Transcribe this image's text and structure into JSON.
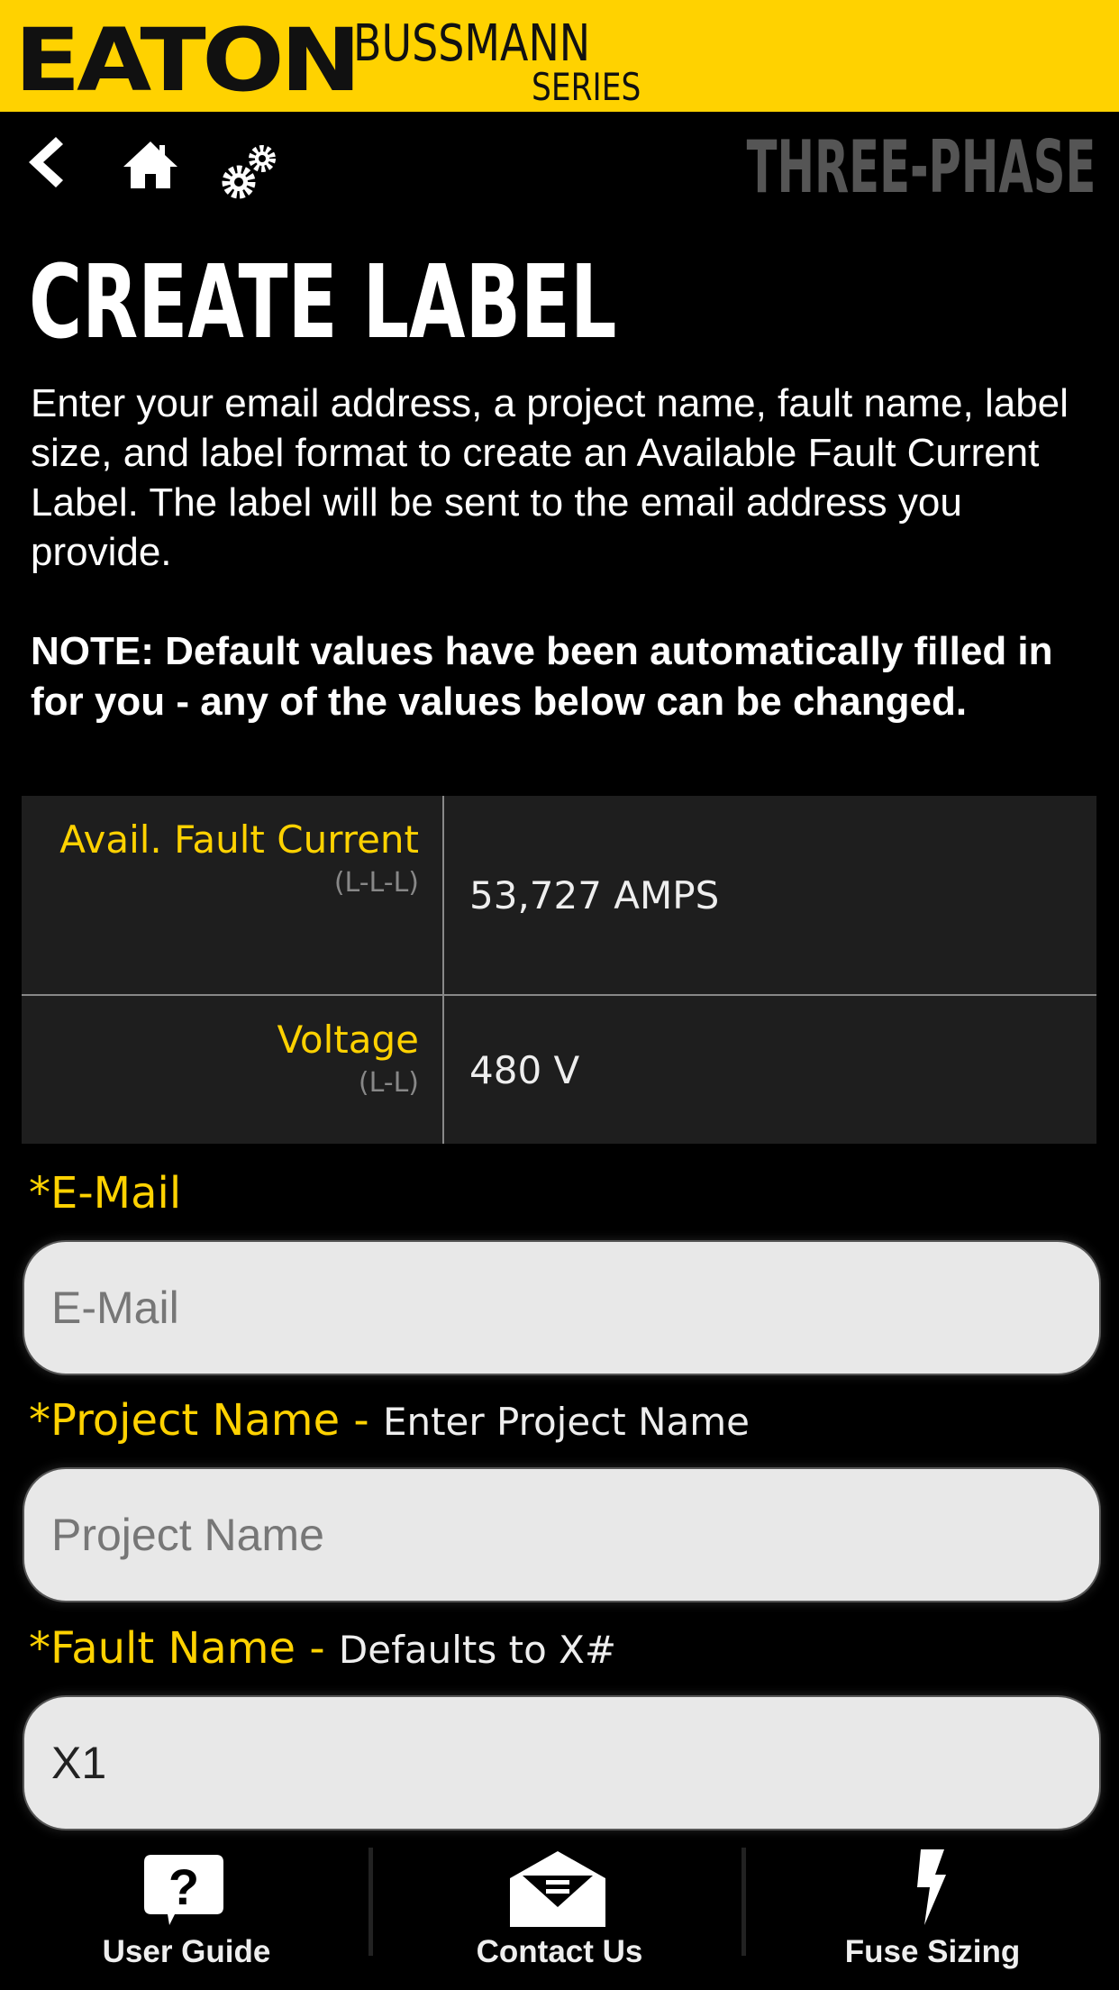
{
  "header": {
    "brand": "EATON",
    "sub_brand": "BUSSMANN",
    "sub_brand_series": "SERIES",
    "brand_color": "#ffd200"
  },
  "nav": {
    "back_icon": "chevron-left-icon",
    "home_icon": "home-icon",
    "settings_icon": "gears-icon",
    "mode": "THREE-PHASE"
  },
  "page": {
    "title": "CREATE LABEL",
    "intro": "Enter your email address, a project name, fault name, label size, and label format to create an Available Fault Current Label. The label will be sent to the email address you provide.",
    "note": "NOTE: Default values have been automatically filled in for you - any of the values below can be changed."
  },
  "summary": [
    {
      "label": "Avail. Fault Current",
      "sub": "(L-L-L)",
      "value": "53,727 AMPS"
    },
    {
      "label": "Voltage",
      "sub": "(L-L)",
      "value": "480 V"
    }
  ],
  "form": {
    "email": {
      "label": "*E-Mail",
      "hint": "",
      "placeholder": "E-Mail",
      "value": ""
    },
    "project": {
      "label": "*Project Name - ",
      "hint": "Enter Project Name",
      "placeholder": "Project Name",
      "value": ""
    },
    "fault": {
      "label": "*Fault Name - ",
      "hint": "Defaults to X#",
      "placeholder": "",
      "value": "X1"
    }
  },
  "bottom_nav": [
    {
      "label": "User Guide",
      "icon": "help-bubble-icon"
    },
    {
      "label": "Contact Us",
      "icon": "envelope-icon"
    },
    {
      "label": "Fuse Sizing",
      "icon": "lightning-icon"
    }
  ]
}
